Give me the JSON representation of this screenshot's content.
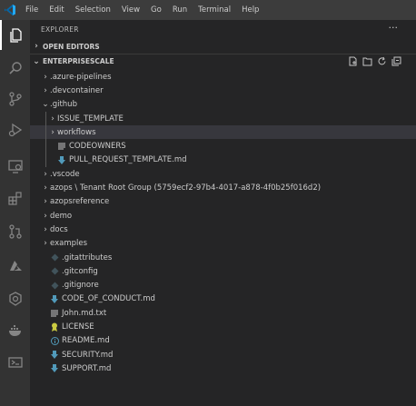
{
  "menu": [
    "File",
    "Edit",
    "Selection",
    "View",
    "Go",
    "Run",
    "Terminal",
    "Help"
  ],
  "sidebar": {
    "title": "EXPLORER",
    "more": "···",
    "open_editors": "OPEN EDITORS",
    "workspace": "ENTERPRISESCALE"
  },
  "tree": [
    {
      "label": ".azure-pipelines",
      "type": "folder",
      "depth": 0,
      "expanded": false
    },
    {
      "label": ".devcontainer",
      "type": "folder",
      "depth": 0,
      "expanded": false
    },
    {
      "label": ".github",
      "type": "folder",
      "depth": 0,
      "expanded": true
    },
    {
      "label": "ISSUE_TEMPLATE",
      "type": "folder",
      "depth": 1,
      "expanded": false
    },
    {
      "label": "workflows",
      "type": "folder",
      "depth": 1,
      "expanded": false,
      "selected": true
    },
    {
      "label": "CODEOWNERS",
      "type": "lines",
      "depth": 1
    },
    {
      "label": "PULL_REQUEST_TEMPLATE.md",
      "type": "md",
      "depth": 1
    },
    {
      "label": ".vscode",
      "type": "folder",
      "depth": 0,
      "expanded": false
    },
    {
      "label": "azops \\ Tenant Root Group (5759ecf2-97b4-4017-a878-4f0b25f016d2)",
      "type": "folder",
      "depth": 0,
      "expanded": false
    },
    {
      "label": "azopsreference",
      "type": "folder",
      "depth": 0,
      "expanded": false
    },
    {
      "label": "demo",
      "type": "folder",
      "depth": 0,
      "expanded": false
    },
    {
      "label": "docs",
      "type": "folder",
      "depth": 0,
      "expanded": false
    },
    {
      "label": "examples",
      "type": "folder",
      "depth": 0,
      "expanded": false
    },
    {
      "label": ".gitattributes",
      "type": "git",
      "depth": 0
    },
    {
      "label": ".gitconfig",
      "type": "git",
      "depth": 0
    },
    {
      "label": ".gitignore",
      "type": "git",
      "depth": 0
    },
    {
      "label": "CODE_OF_CONDUCT.md",
      "type": "md",
      "depth": 0
    },
    {
      "label": "John.md.txt",
      "type": "lines",
      "depth": 0
    },
    {
      "label": "LICENSE",
      "type": "license",
      "depth": 0
    },
    {
      "label": "README.md",
      "type": "info",
      "depth": 0
    },
    {
      "label": "SECURITY.md",
      "type": "md",
      "depth": 0
    },
    {
      "label": "SUPPORT.md",
      "type": "md",
      "depth": 0
    }
  ],
  "colors": {
    "accent": "#007acc",
    "md_icon": "#519aba",
    "git_icon": "#41535b",
    "license_icon": "#cbcb41"
  }
}
